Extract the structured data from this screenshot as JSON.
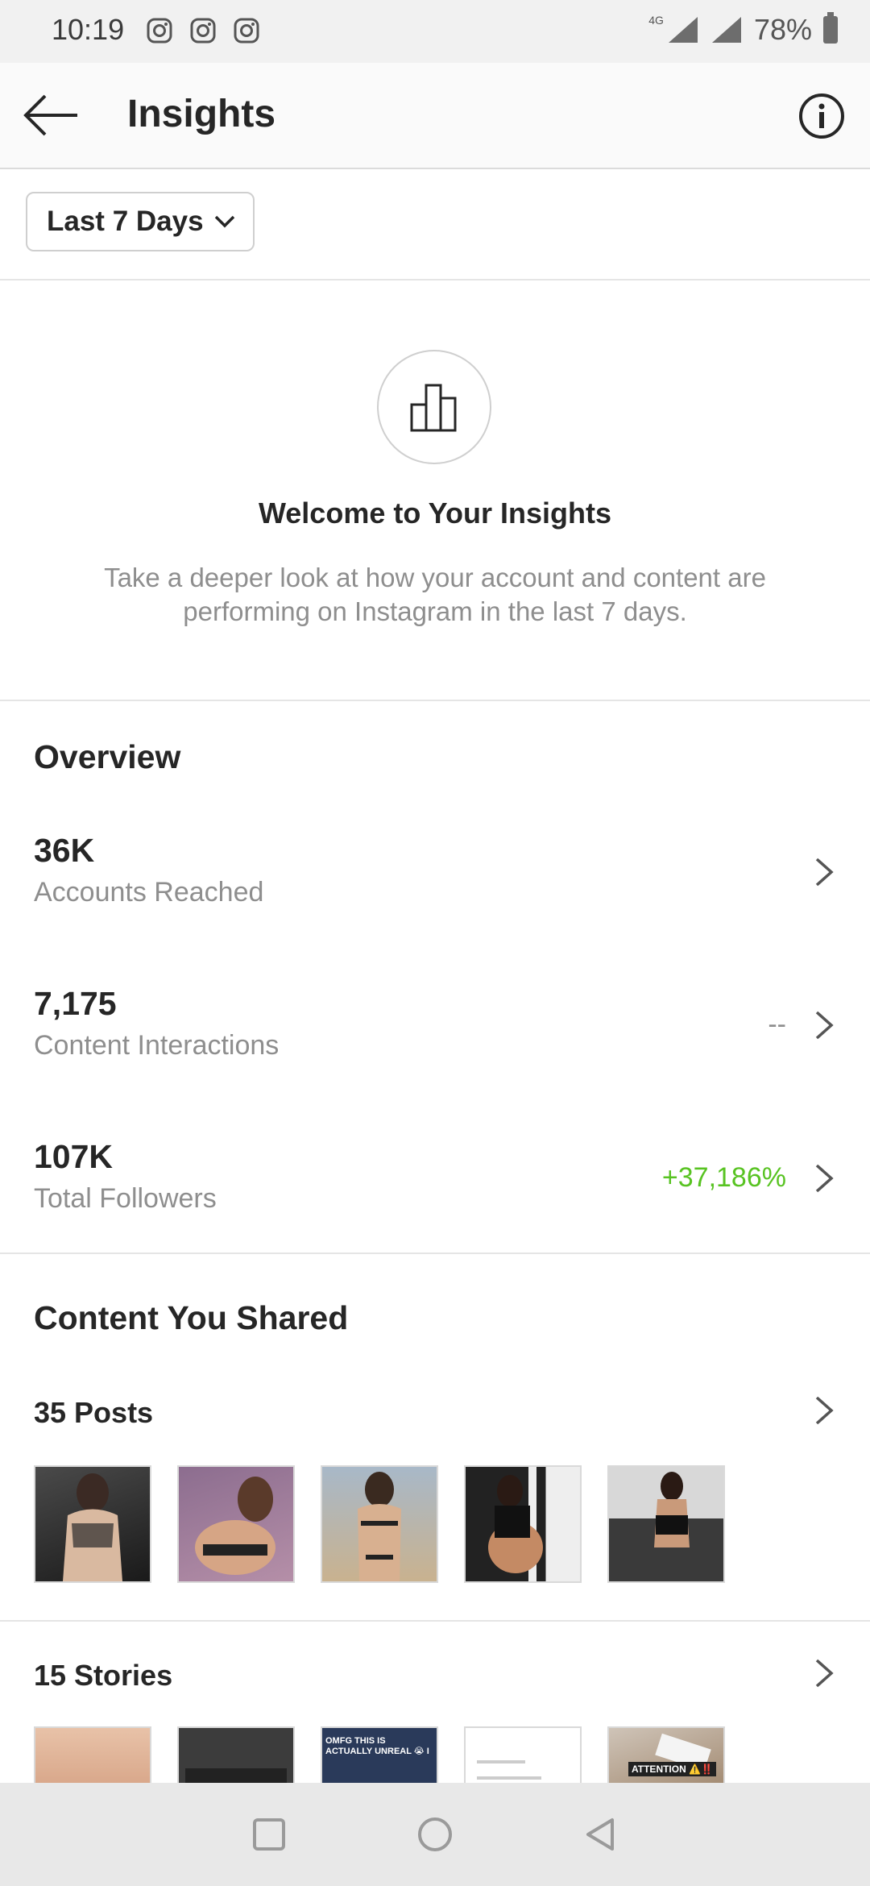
{
  "status_bar": {
    "time": "10:19",
    "network": "4G",
    "battery": "78%"
  },
  "header": {
    "title": "Insights"
  },
  "filter": {
    "range_label": "Last 7 Days"
  },
  "welcome": {
    "title": "Welcome to Your Insights",
    "text": "Take a deeper look at how your account and content are performing on Instagram in the last 7 days."
  },
  "overview": {
    "title": "Overview",
    "metrics": [
      {
        "value": "36K",
        "label": "Accounts Reached",
        "change": ""
      },
      {
        "value": "7,175",
        "label": "Content Interactions",
        "change": "--"
      },
      {
        "value": "107K",
        "label": "Total Followers",
        "change": "+37,186%"
      }
    ]
  },
  "content": {
    "title": "Content You Shared",
    "posts_label": "35 Posts",
    "stories_label": "15 Stories",
    "story_texts": [
      "OMFG THIS IS ACTUALLY UNREAL 😭 I THOUGHT IT WAS A SCAM AT FIRST",
      "ATTENTION ⚠️‼️"
    ]
  },
  "colors": {
    "positive": "#58c322",
    "muted": "#8e8e8e",
    "text": "#262626"
  }
}
